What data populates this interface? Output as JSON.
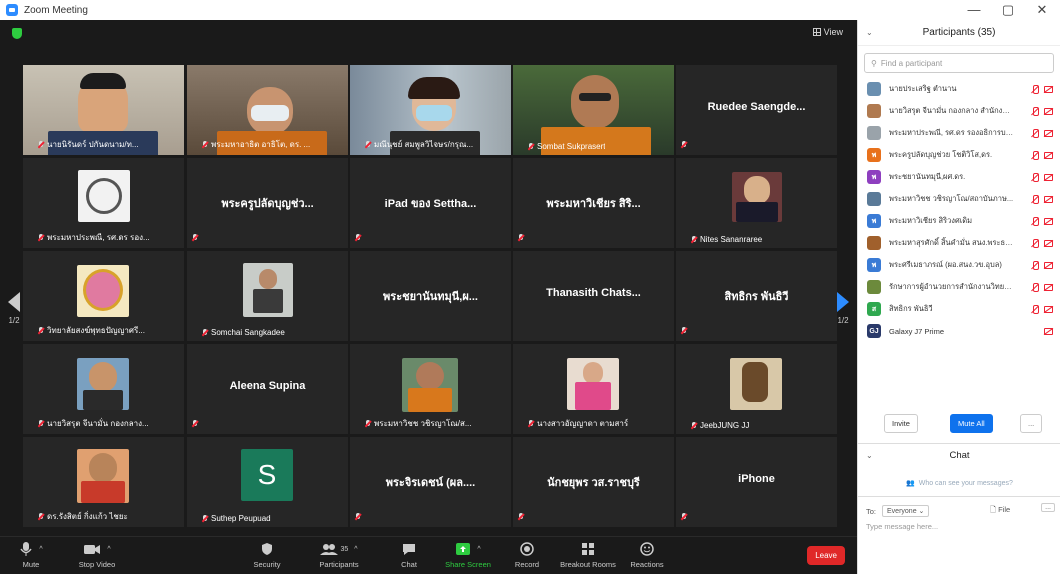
{
  "window": {
    "title": "Zoom Meeting",
    "minimize": "—",
    "maximize": "▢",
    "close": "✕"
  },
  "video": {
    "view_label": "View",
    "page_left": "1/2",
    "page_right": "1/2"
  },
  "tiles": [
    {
      "name": "นายนิรันดร์ ปกันดนาม/ท..."
    },
    {
      "name": "พระมหาอาธิต อาธิโต, ดร. ..."
    },
    {
      "name": "มณีนุชย์ สมพูลวิไจษร/กรุณ..."
    },
    {
      "name": "Sombat Sukprasert"
    },
    {
      "center": "Ruedee Saengde..."
    },
    {
      "name": "พระมหาประพณี, รศ.ดร รอง..."
    },
    {
      "center": "พระครูปลัดบุญช่ว..."
    },
    {
      "center": "iPad ของ Settha..."
    },
    {
      "center": "พระมหาวิเชียร สิริ..."
    },
    {
      "name": "Nites Sananraree"
    },
    {
      "name": "วิทยาลัยสงฆ์พุทธปัญญาศรี..."
    },
    {
      "name": "Somchai Sangkadee"
    },
    {
      "center": "พระชยานันทมุนี,ผ..."
    },
    {
      "center": "Thanasith Chats..."
    },
    {
      "center": "สิทธิกร พันธิวี"
    },
    {
      "name": "นายวิสรุต จีนามั่น กองกลาง..."
    },
    {
      "center": "Aleena Supina"
    },
    {
      "name": "พระมหาวิชช วชิรญาโณ/ส..."
    },
    {
      "name": "นางสาวอัญญาดา ตามสาร์"
    },
    {
      "name": "JeebJUNG JJ"
    },
    {
      "name": "ดร.รังสิตย์ กิ่งแก้ว ไชยะ"
    },
    {
      "name": "Suthep Peupuad",
      "initial": "S"
    },
    {
      "center": "พระจิรเดชน์ (ผล...."
    },
    {
      "center": "นักชยุพร วส.ราชบุรี"
    },
    {
      "center": "iPhone"
    }
  ],
  "toolbar": {
    "mute": "Mute",
    "stop_video": "Stop Video",
    "security": "Security",
    "participants": "Participants",
    "participants_count": "35",
    "chat": "Chat",
    "share_screen": "Share Screen",
    "record": "Record",
    "breakout": "Breakout Rooms",
    "reactions": "Reactions",
    "leave": "Leave"
  },
  "participants": {
    "title": "Participants (35)",
    "search_placeholder": "Find a participant",
    "items": [
      {
        "name": "นายประเสริฐ ตำนาน",
        "initials": "",
        "color": "#6a8fb0"
      },
      {
        "name": "นายวิสรุต จีนามั่น กองกลาง สำนักงาน...",
        "initials": "",
        "color": "#b07a50"
      },
      {
        "name": "พระมหาประพณี, รศ.ดร รองอธิการบดี...",
        "initials": "",
        "color": "#9aa3aa"
      },
      {
        "name": "พระครูปลัดบุญช่วย โชติวิโส,ดร.",
        "initials": "พ",
        "color": "#e8711c"
      },
      {
        "name": "พระชยานันทมุนี,ผศ.ดร.",
        "initials": "พ",
        "color": "#8e3fbf"
      },
      {
        "name": "พระมหาวิชช วชิรญาโณ/สถาบันภาษ...",
        "initials": "",
        "color": "#5a7a98"
      },
      {
        "name": "พระมหาวิเชียร สิริวงศเดิม",
        "initials": "พ",
        "color": "#3a7bd5"
      },
      {
        "name": "พระมหาสุรศักดิ์ สิ้นคํามั่น สนง.พระธรรม...",
        "initials": "",
        "color": "#a0602c"
      },
      {
        "name": "พระศรีเมธาภรณ์ (ผอ.สนง.วข.อุบล)",
        "initials": "พ",
        "color": "#3a7bd5"
      },
      {
        "name": "รักษาการผู้อำนวยการสำนักงานวิทยา...",
        "initials": "",
        "color": "#6c8a3c"
      },
      {
        "name": "สิทธิกร พันธิวี",
        "initials": "ส",
        "color": "#2fa84f"
      },
      {
        "name": "Galaxy J7 Prime",
        "initials": "GJ",
        "color": "#2a3a6a"
      }
    ],
    "invite": "Invite",
    "mute_all": "Mute All",
    "more": "..."
  },
  "chat": {
    "title": "Chat",
    "who_can_see": "Who can see your messages?",
    "to_label": "To:",
    "to_value": "Everyone",
    "file": "File",
    "more": "...",
    "placeholder": "Type message here..."
  }
}
